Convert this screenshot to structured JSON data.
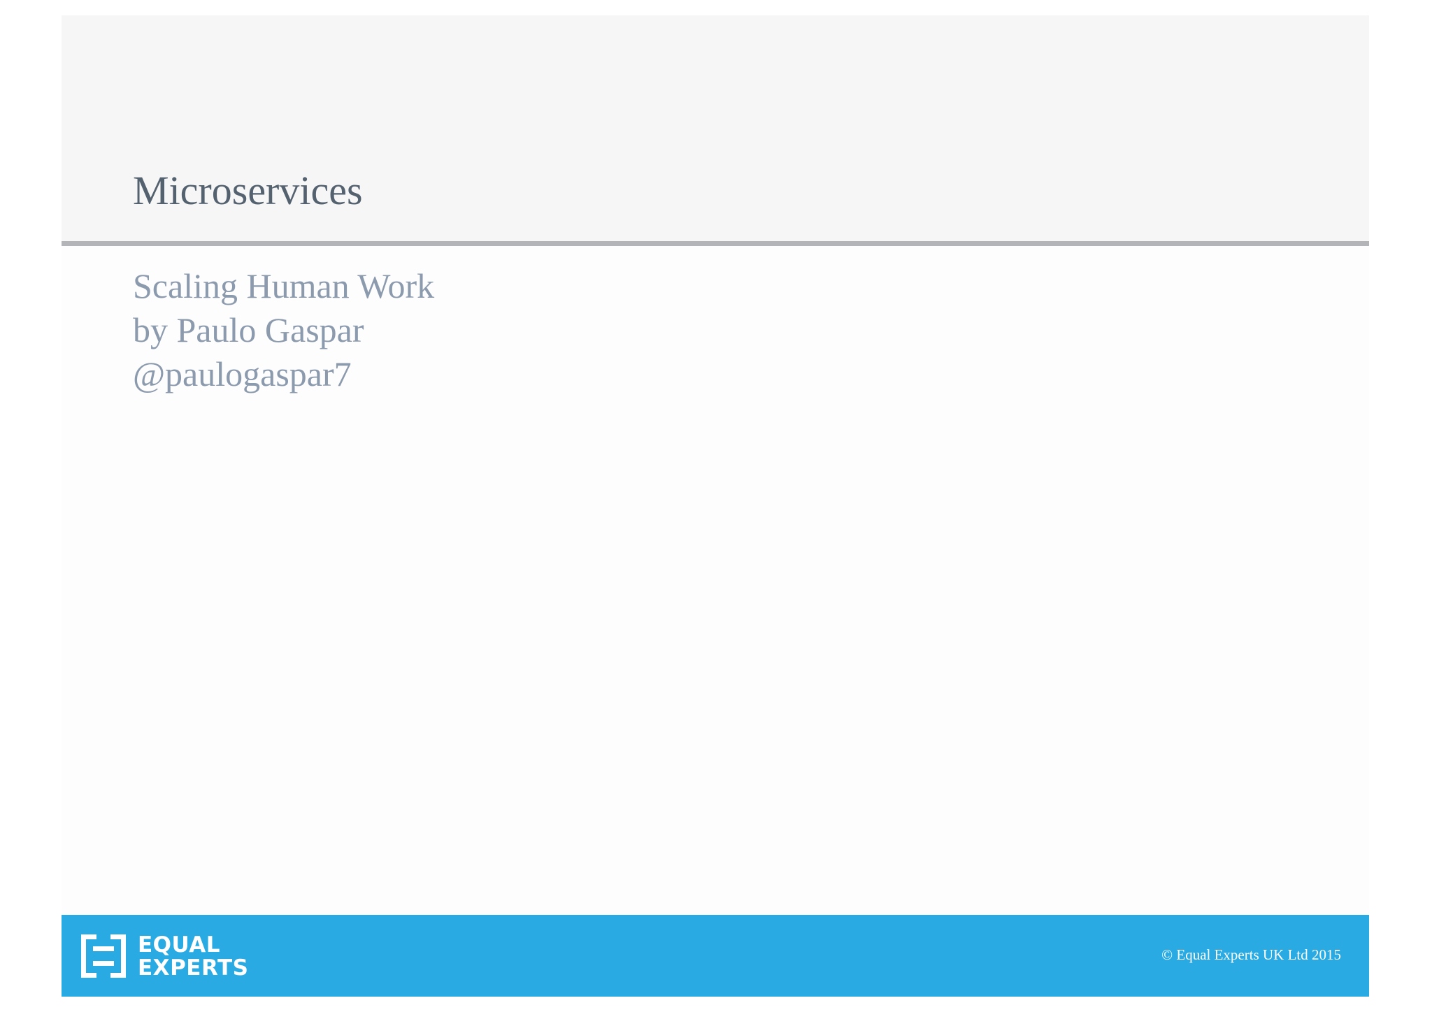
{
  "slide": {
    "title": "Microservices",
    "subtitle_lines": [
      "Scaling Human Work",
      "by Paulo Gaspar",
      "@paulogaspar7"
    ]
  },
  "footer": {
    "logo": {
      "line1": "EQUAL",
      "line2": "EXPERTS",
      "icon": "equal-experts-logo-icon"
    },
    "copyright": "© Equal Experts UK Ltd 2015"
  },
  "colors": {
    "footer_background": "#29aae2",
    "title_text": "#54616f",
    "subtitle_text": "#8c9aae",
    "title_band": "#f6f6f6",
    "rule": "#b3b4b7"
  }
}
